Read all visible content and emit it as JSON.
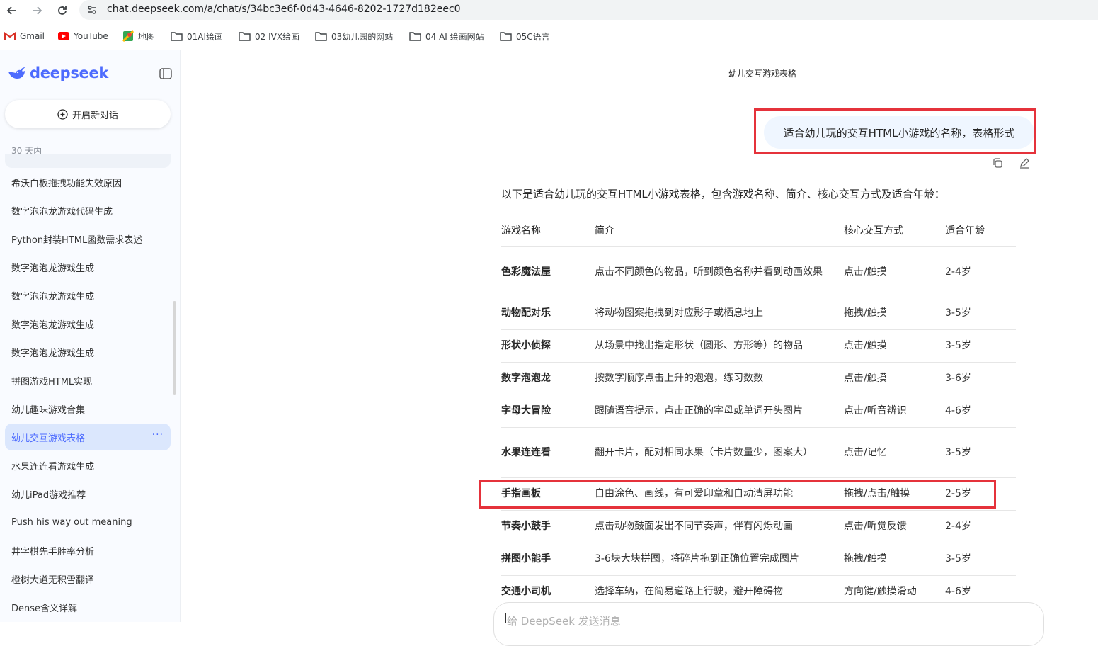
{
  "browser": {
    "url": "chat.deepseek.com/a/chat/s/34bc3e6f-0d43-4646-8202-1727d182eec0",
    "bookmarks": [
      {
        "label": "Gmail",
        "icon": "gmail-icon"
      },
      {
        "label": "YouTube",
        "icon": "youtube-icon"
      },
      {
        "label": "地图",
        "icon": "maps-icon"
      },
      {
        "label": "01AI绘画",
        "icon": "folder-icon"
      },
      {
        "label": "02 IVX绘画",
        "icon": "folder-icon"
      },
      {
        "label": "03幼儿园的网站",
        "icon": "folder-icon"
      },
      {
        "label": "04 AI 绘画网站",
        "icon": "folder-icon"
      },
      {
        "label": "05C语言",
        "icon": "folder-icon"
      }
    ]
  },
  "sidebar": {
    "logo": "deepseek",
    "new_chat": "开启新对话",
    "section_label": "30 天内",
    "items": [
      {
        "label": "希沃白板拖拽功能失效原因"
      },
      {
        "label": "数字泡泡龙游戏代码生成"
      },
      {
        "label": "Python封装HTML函数需求表述"
      },
      {
        "label": "数字泡泡龙游戏生成"
      },
      {
        "label": "数字泡泡龙游戏生成"
      },
      {
        "label": "数字泡泡龙游戏生成"
      },
      {
        "label": "数字泡泡龙游戏生成"
      },
      {
        "label": "拼图游戏HTML实现"
      },
      {
        "label": "幼儿趣味游戏合集"
      },
      {
        "label": "幼儿交互游戏表格",
        "active": true
      },
      {
        "label": "水果连连看游戏生成"
      },
      {
        "label": "幼儿iPad游戏推荐"
      },
      {
        "label": "Push his way out meaning"
      },
      {
        "label": "井字棋先手胜率分析"
      },
      {
        "label": "橙树大道无积雪翻译"
      },
      {
        "label": "Dense含义详解"
      }
    ]
  },
  "chat": {
    "title": "幼儿交互游戏表格",
    "user_message": "适合幼儿玩的交互HTML小游戏的名称，表格形式",
    "intro": "以下是适合幼儿玩的交互HTML小游戏表格，包含游戏名称、简介、核心交互方式及适合年龄：",
    "table": {
      "headers": [
        "游戏名称",
        "简介",
        "核心交互方式",
        "适合年龄"
      ],
      "rows": [
        [
          "色彩魔法屋",
          "点击不同颜色的物品，听到颜色名称并看到动画效果",
          "点击/触摸",
          "2-4岁"
        ],
        [
          "动物配对乐",
          "将动物图案拖拽到对应影子或栖息地上",
          "拖拽/触摸",
          "3-5岁"
        ],
        [
          "形状小侦探",
          "从场景中找出指定形状（圆形、方形等）的物品",
          "点击/触摸",
          "3-5岁"
        ],
        [
          "数字泡泡龙",
          "按数字顺序点击上升的泡泡，练习数数",
          "点击/触摸",
          "3-6岁"
        ],
        [
          "字母大冒险",
          "跟随语音提示，点击正确的字母或单词开头图片",
          "点击/听音辨识",
          "4-6岁"
        ],
        [
          "水果连连看",
          "翻开卡片，配对相同水果（卡片数量少，图案大）",
          "点击/记忆",
          "3-5岁"
        ],
        [
          "手指画板",
          "自由涂色、画线，有可爱印章和自动清屏功能",
          "拖拽/点击/触摸",
          "2-5岁"
        ],
        [
          "节奏小鼓手",
          "点击动物鼓面发出不同节奏声，伴有闪烁动画",
          "点击/听觉反馈",
          "2-4岁"
        ],
        [
          "拼图小能手",
          "3-6块大块拼图，将碎片拖到正确位置完成图片",
          "拖拽/触摸",
          "3-5岁"
        ],
        [
          "交通小司机",
          "选择车辆，在简易道路上行驶，避开障碍物",
          "方向键/触摸滑动",
          "4-6岁"
        ]
      ]
    },
    "input_placeholder": "给 DeepSeek 发送消息"
  },
  "colors": {
    "brand": "#4d6bfe",
    "highlight": "#e5323b"
  }
}
